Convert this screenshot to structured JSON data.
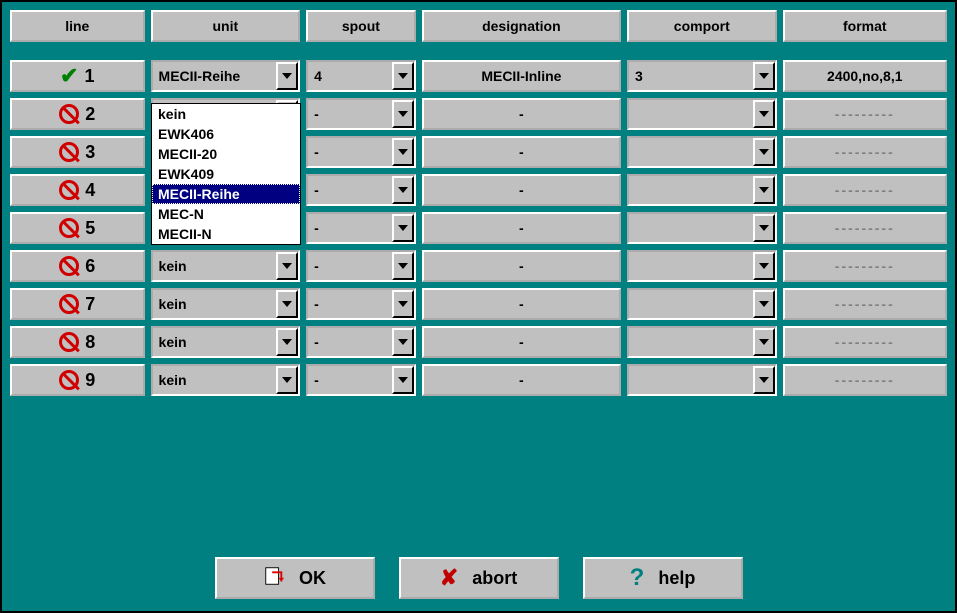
{
  "headers": {
    "line": "line",
    "unit": "unit",
    "spout": "spout",
    "designation": "designation",
    "comport": "comport",
    "format": "format"
  },
  "rows": [
    {
      "num": "1",
      "status": "ok",
      "unit": "MECII-Reihe",
      "spout": "4",
      "designation": "MECII-Inline",
      "comport": "3",
      "format": "2400,no,8,1"
    },
    {
      "num": "2",
      "status": "deny",
      "unit": "",
      "spout": "-",
      "designation": "-",
      "comport": "",
      "format": "---------"
    },
    {
      "num": "3",
      "status": "deny",
      "unit": "",
      "spout": "-",
      "designation": "-",
      "comport": "",
      "format": "---------"
    },
    {
      "num": "4",
      "status": "deny",
      "unit": "",
      "spout": "-",
      "designation": "-",
      "comport": "",
      "format": "---------"
    },
    {
      "num": "5",
      "status": "deny",
      "unit": "kein",
      "spout": "-",
      "designation": "-",
      "comport": "",
      "format": "---------"
    },
    {
      "num": "6",
      "status": "deny",
      "unit": "kein",
      "spout": "-",
      "designation": "-",
      "comport": "",
      "format": "---------"
    },
    {
      "num": "7",
      "status": "deny",
      "unit": "kein",
      "spout": "-",
      "designation": "-",
      "comport": "",
      "format": "---------"
    },
    {
      "num": "8",
      "status": "deny",
      "unit": "kein",
      "spout": "-",
      "designation": "-",
      "comport": "",
      "format": "---------"
    },
    {
      "num": "9",
      "status": "deny",
      "unit": "kein",
      "spout": "-",
      "designation": "-",
      "comport": "",
      "format": "---------"
    }
  ],
  "dropdown": {
    "options": [
      "kein",
      "EWK406",
      "MECII-20",
      "EWK409",
      "MECII-Reihe",
      "MEC-N",
      "MECII-N"
    ],
    "selected": "MECII-Reihe"
  },
  "buttons": {
    "ok": "OK",
    "abort": "abort",
    "help": "help"
  }
}
